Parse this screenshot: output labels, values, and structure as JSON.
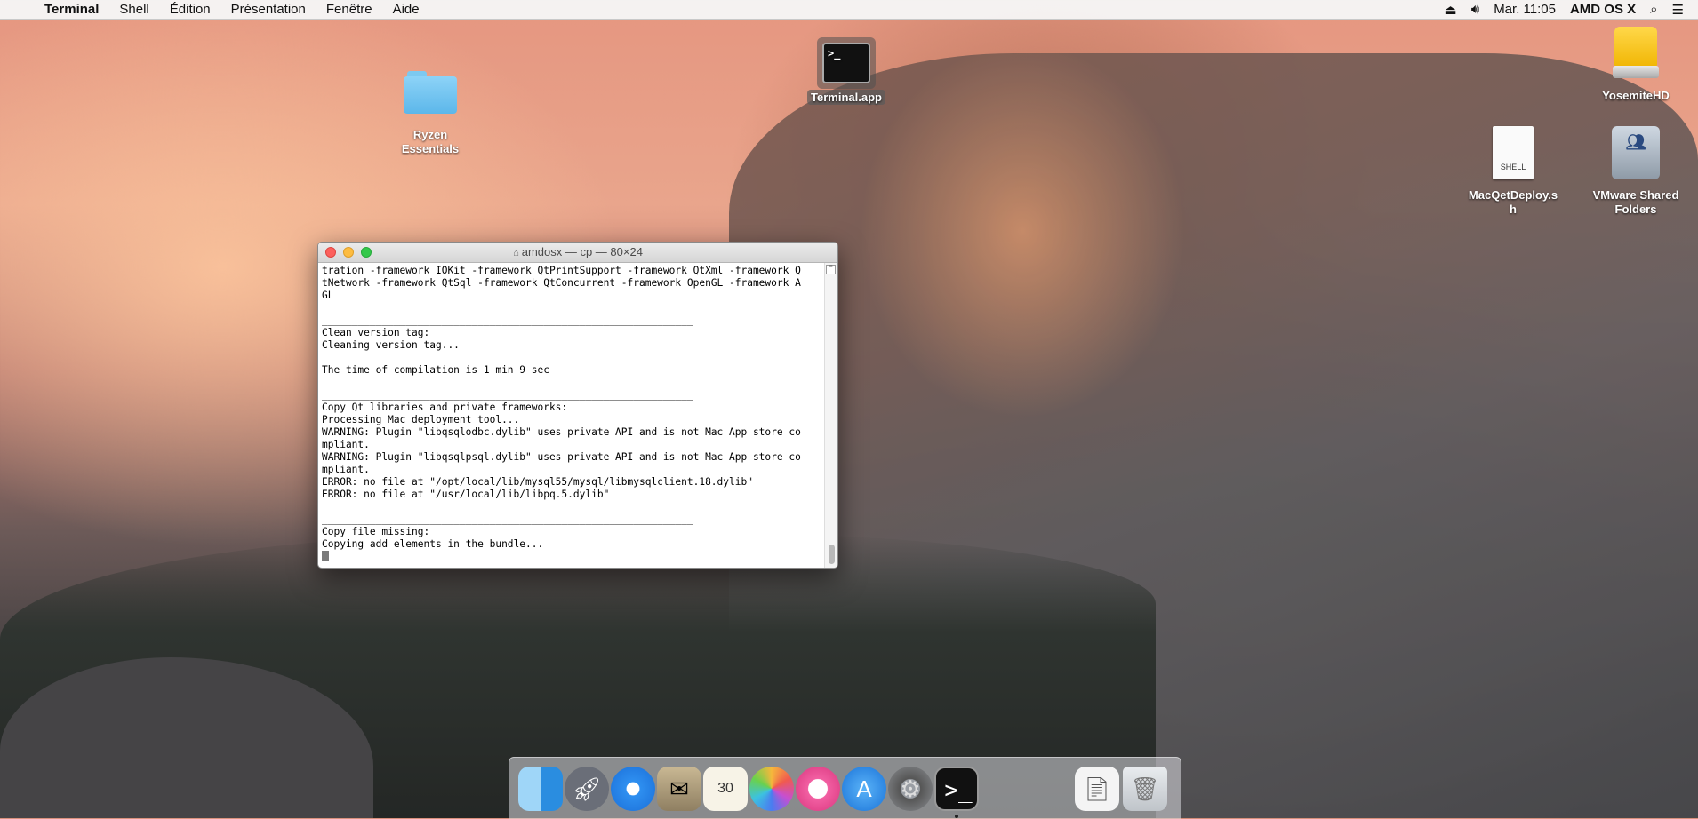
{
  "menubar": {
    "apple_glyph": "",
    "app_name": "Terminal",
    "menus": [
      "Shell",
      "Édition",
      "Présentation",
      "Fenêtre",
      "Aide"
    ],
    "clock": "Mar. 11:05",
    "user": "AMD OS X"
  },
  "desktop": {
    "icons": [
      {
        "label_line1": "Ryzen",
        "label_line2": "Essentials"
      },
      {
        "label": "Terminal.app",
        "glyph": ">_"
      },
      {
        "label": "YosemiteHD"
      },
      {
        "label_line1": "MacQetDeploy.s",
        "label_line2": "h",
        "badge": "SHELL"
      },
      {
        "label_line1": "VMware Shared",
        "label_line2": "Folders"
      }
    ]
  },
  "terminal": {
    "title": "amdosx — cp — 80×24",
    "lines": [
      "tration -framework IOKit -framework QtPrintSupport -framework QtXml -framework Q",
      "tNetwork -framework QtSql -framework QtConcurrent -framework OpenGL -framework A",
      "GL",
      "",
      "______________________________________________________________",
      "Clean version tag:",
      "Cleaning version tag...",
      "",
      "The time of compilation is 1 min 9 sec",
      "",
      "______________________________________________________________",
      "Copy Qt libraries and private frameworks:",
      "Processing Mac deployment tool...",
      "WARNING: Plugin \"libqsqlodbc.dylib\" uses private API and is not Mac App store co",
      "mpliant.",
      "WARNING: Plugin \"libqsqlpsql.dylib\" uses private API and is not Mac App store co",
      "mpliant.",
      "ERROR: no file at \"/opt/local/lib/mysql55/mysql/libmysqlclient.18.dylib\"",
      "ERROR: no file at \"/usr/local/lib/libpq.5.dylib\"",
      "",
      "______________________________________________________________",
      "Copy file missing:",
      "Copying add elements in the bundle..."
    ]
  },
  "dock": {
    "apps": [
      "finder",
      "launchpad",
      "safari",
      "mail",
      "calendar",
      "photos",
      "itunes",
      "app-store",
      "system-preferences",
      "terminal",
      "documents",
      "trash"
    ],
    "calendar_day": "30"
  }
}
